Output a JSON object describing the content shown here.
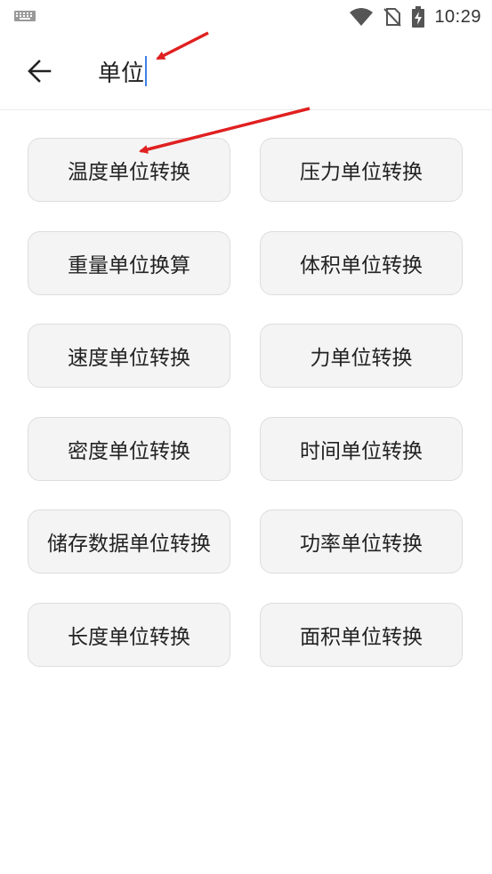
{
  "status_bar": {
    "time": "10:29",
    "icons": [
      "keyboard-icon",
      "wifi-icon",
      "no-sim-icon",
      "battery-charging-icon"
    ]
  },
  "header": {
    "back_icon": "arrow-left-icon",
    "search_value": "单位"
  },
  "converters": [
    {
      "label": "温度单位转换"
    },
    {
      "label": "压力单位转换"
    },
    {
      "label": "重量单位换算"
    },
    {
      "label": "体积单位转换"
    },
    {
      "label": "速度单位转换"
    },
    {
      "label": "力单位转换"
    },
    {
      "label": "密度单位转换"
    },
    {
      "label": "时间单位转换"
    },
    {
      "label": "储存数据单位转换"
    },
    {
      "label": "功率单位转换"
    },
    {
      "label": "长度单位转换"
    },
    {
      "label": "面积单位转换"
    }
  ],
  "colors": {
    "annotation_arrow": "#e02020",
    "caret": "#3f7fe6",
    "button_bg": "#f4f4f4"
  }
}
